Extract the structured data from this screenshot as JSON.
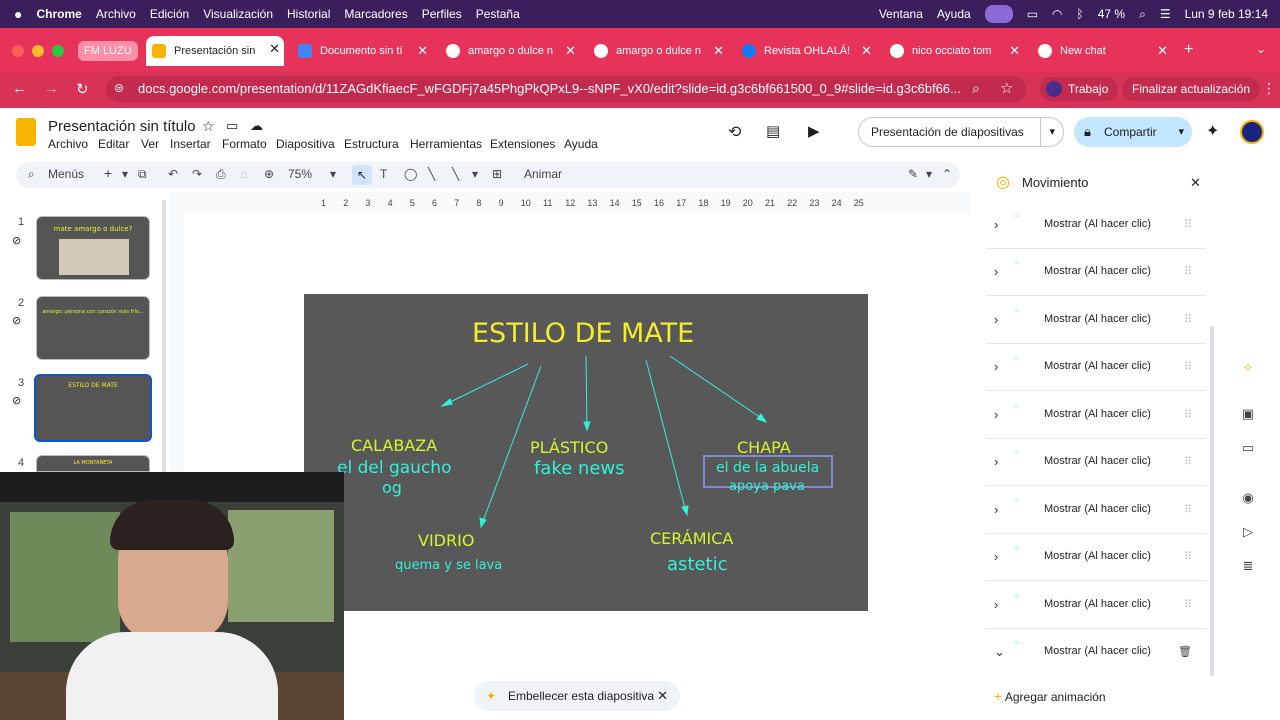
{
  "menubar": {
    "app": "Chrome",
    "items": [
      "Archivo",
      "Edición",
      "Visualización",
      "Historial",
      "Marcadores",
      "Perfiles",
      "Pestaña",
      "Ventana",
      "Ayuda"
    ],
    "battery": "47 %",
    "datetime": "Lun 9 feb 19:14"
  },
  "tabs": {
    "group_label": "FM LUZU",
    "items": [
      {
        "label": "Presentación sin"
      },
      {
        "label": "Documento sin tí"
      },
      {
        "label": "amargo o dulce n"
      },
      {
        "label": "amargo o dulce n"
      },
      {
        "label": "Revista OHLALÁ!"
      },
      {
        "label": "nico occiato tom"
      },
      {
        "label": "New chat"
      }
    ]
  },
  "browser": {
    "url": "docs.google.com/presentation/d/11ZAGdKfiaecF_wFGDFj7a45PhgPkQPxL9--sNPF_vX0/edit?slide=id.g3c6bf661500_0_9#slide=id.g3c6bf66...",
    "profile": "Trabajo",
    "update": "Finalizar actualización"
  },
  "doc": {
    "title": "Presentación sin título",
    "menus": [
      "Archivo",
      "Editar",
      "Ver",
      "Insertar",
      "Formato",
      "Diapositiva",
      "Estructura",
      "Herramientas",
      "Extensiones",
      "Ayuda"
    ],
    "slideshow_label": "Presentación de diapositivas",
    "share_label": "Compartir"
  },
  "toolbar": {
    "search": "Menús",
    "zoom": "75%",
    "animate": "Animar"
  },
  "ruler": [
    "1",
    "2",
    "3",
    "4",
    "5",
    "6",
    "7",
    "8",
    "9",
    "10",
    "11",
    "12",
    "13",
    "14",
    "15",
    "16",
    "17",
    "18",
    "19",
    "20",
    "21",
    "22",
    "23",
    "24",
    "25"
  ],
  "thumbnails": [
    {
      "num": "1",
      "text": "mate amargo o dulce?"
    },
    {
      "num": "2",
      "text": "amargo: persona con corazón más frío..."
    },
    {
      "num": "3",
      "text": "ESTILO DE MATE"
    },
    {
      "num": "4",
      "text": "LA MONTAÑETA"
    }
  ],
  "slide": {
    "title": "ESTILO DE MATE",
    "calabaza": "CALABAZA",
    "calabaza_sub1": "el del gaucho",
    "calabaza_sub2": "og",
    "plastico": "PLÁSTICO",
    "plastico_sub": "fake news",
    "chapa": "CHAPA",
    "chapa_sub1": "el de la abuela",
    "chapa_sub2": "apoya pava",
    "vidrio": "VIDRIO",
    "vidrio_sub": "quema y se lava",
    "ceramica": "CERÁMICA",
    "ceramica_sub": "astetic"
  },
  "panel": {
    "title": "Movimiento",
    "rows": [
      "Mostrar  (Al hacer clic)",
      "Mostrar  (Al hacer clic)",
      "Mostrar  (Al hacer clic)",
      "Mostrar  (Al hacer clic)",
      "Mostrar  (Al hacer clic)",
      "Mostrar  (Al hacer clic)",
      "Mostrar  (Al hacer clic)",
      "Mostrar  (Al hacer clic)",
      "Mostrar  (Al hacer clic)",
      "Mostrar  (Al hacer clic)"
    ],
    "add": "Agregar animación"
  },
  "embellish": "Embellecer esta diapositiva",
  "colors": {
    "slide_bg": "#585858",
    "title": "#f2ee2b",
    "heading": "#d6f52e",
    "body": "#33f0d8",
    "tab_strip": "#e7335a"
  }
}
